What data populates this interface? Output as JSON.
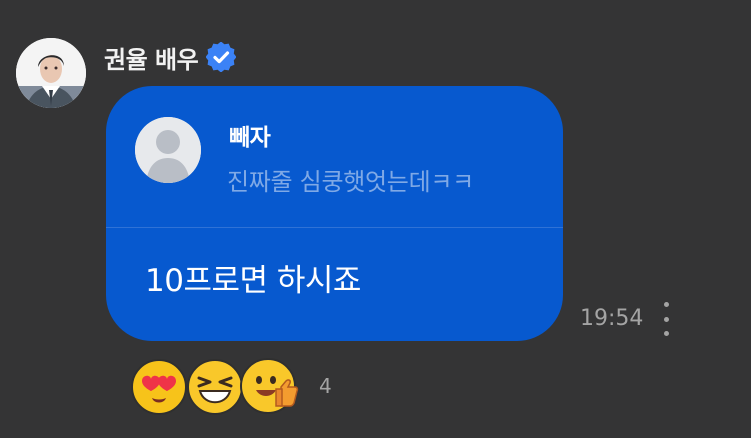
{
  "chat": {
    "sender_name": "권율 배우",
    "reply": {
      "author": "빼자",
      "preview": "진짜줄 심쿵햇엇는데ㅋㅋ"
    },
    "message": "10프로면 하시죠",
    "time": "19:54",
    "reactions": [
      "heart-eyes-emoji",
      "laughing-emoji",
      "thumbs-up-emoji"
    ],
    "reaction_count": "4"
  },
  "colors": {
    "background": "#343435",
    "bubble": "#0759cf",
    "verified_badge": "#3b82f6",
    "reply_preview": "#7fa9e6",
    "meta_text": "#a4a4a4"
  },
  "icons": {
    "verified": "verified-badge-icon",
    "more": "more-vertical-icon",
    "default_avatar": "default-avatar-icon"
  }
}
